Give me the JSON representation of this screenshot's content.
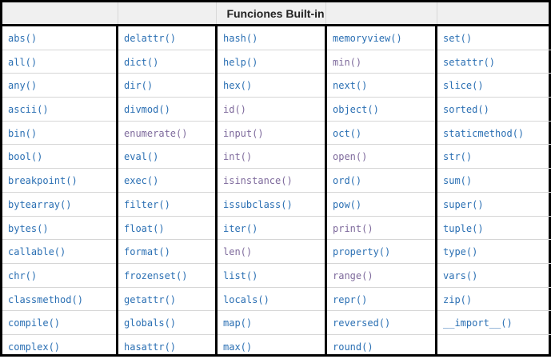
{
  "title": "Funciones Built-in",
  "colors": {
    "link": "#2a6fb3",
    "visited": "#7e6a9c",
    "border": "#000000",
    "header_bg": "#f0f0f0"
  },
  "columns": [
    {
      "items": [
        {
          "text": "abs()",
          "state": "link"
        },
        {
          "text": "all()",
          "state": "link"
        },
        {
          "text": "any()",
          "state": "link"
        },
        {
          "text": "ascii()",
          "state": "link"
        },
        {
          "text": "bin()",
          "state": "link"
        },
        {
          "text": "bool()",
          "state": "link"
        },
        {
          "text": "breakpoint()",
          "state": "link"
        },
        {
          "text": "bytearray()",
          "state": "link"
        },
        {
          "text": "bytes()",
          "state": "link"
        },
        {
          "text": "callable()",
          "state": "link"
        },
        {
          "text": "chr()",
          "state": "link"
        },
        {
          "text": "classmethod()",
          "state": "link"
        },
        {
          "text": "compile()",
          "state": "link"
        },
        {
          "text": "complex()",
          "state": "link"
        }
      ]
    },
    {
      "items": [
        {
          "text": "delattr()",
          "state": "link"
        },
        {
          "text": "dict()",
          "state": "link"
        },
        {
          "text": "dir()",
          "state": "link"
        },
        {
          "text": "divmod()",
          "state": "link"
        },
        {
          "text": "enumerate()",
          "state": "visited"
        },
        {
          "text": "eval()",
          "state": "link"
        },
        {
          "text": "exec()",
          "state": "link"
        },
        {
          "text": "filter()",
          "state": "link"
        },
        {
          "text": "float()",
          "state": "link"
        },
        {
          "text": "format()",
          "state": "link"
        },
        {
          "text": "frozenset()",
          "state": "link"
        },
        {
          "text": "getattr()",
          "state": "link"
        },
        {
          "text": "globals()",
          "state": "link"
        },
        {
          "text": "hasattr()",
          "state": "link"
        }
      ]
    },
    {
      "items": [
        {
          "text": "hash()",
          "state": "link"
        },
        {
          "text": "help()",
          "state": "link"
        },
        {
          "text": "hex()",
          "state": "link"
        },
        {
          "text": "id()",
          "state": "visited"
        },
        {
          "text": "input()",
          "state": "visited"
        },
        {
          "text": "int()",
          "state": "visited"
        },
        {
          "text": "isinstance()",
          "state": "visited"
        },
        {
          "text": "issubclass()",
          "state": "link"
        },
        {
          "text": "iter()",
          "state": "link"
        },
        {
          "text": "len()",
          "state": "visited"
        },
        {
          "text": "list()",
          "state": "link"
        },
        {
          "text": "locals()",
          "state": "link"
        },
        {
          "text": "map()",
          "state": "link"
        },
        {
          "text": "max()",
          "state": "link"
        }
      ]
    },
    {
      "items": [
        {
          "text": "memoryview()",
          "state": "link"
        },
        {
          "text": "min()",
          "state": "visited"
        },
        {
          "text": "next()",
          "state": "link"
        },
        {
          "text": "object()",
          "state": "link"
        },
        {
          "text": "oct()",
          "state": "link"
        },
        {
          "text": "open()",
          "state": "visited"
        },
        {
          "text": "ord()",
          "state": "link"
        },
        {
          "text": "pow()",
          "state": "link"
        },
        {
          "text": "print()",
          "state": "visited"
        },
        {
          "text": "property()",
          "state": "link"
        },
        {
          "text": "range()",
          "state": "visited"
        },
        {
          "text": "repr()",
          "state": "link"
        },
        {
          "text": "reversed()",
          "state": "link"
        },
        {
          "text": "round()",
          "state": "link"
        }
      ]
    },
    {
      "items": [
        {
          "text": "set()",
          "state": "link"
        },
        {
          "text": "setattr()",
          "state": "link"
        },
        {
          "text": "slice()",
          "state": "link"
        },
        {
          "text": "sorted()",
          "state": "link"
        },
        {
          "text": "staticmethod()",
          "state": "link"
        },
        {
          "text": "str()",
          "state": "link"
        },
        {
          "text": "sum()",
          "state": "link"
        },
        {
          "text": "super()",
          "state": "link"
        },
        {
          "text": "tuple()",
          "state": "link"
        },
        {
          "text": "type()",
          "state": "link"
        },
        {
          "text": "vars()",
          "state": "link"
        },
        {
          "text": "zip()",
          "state": "link"
        },
        {
          "text": "__import__()",
          "state": "link"
        },
        {
          "text": "",
          "state": "link"
        }
      ]
    }
  ]
}
